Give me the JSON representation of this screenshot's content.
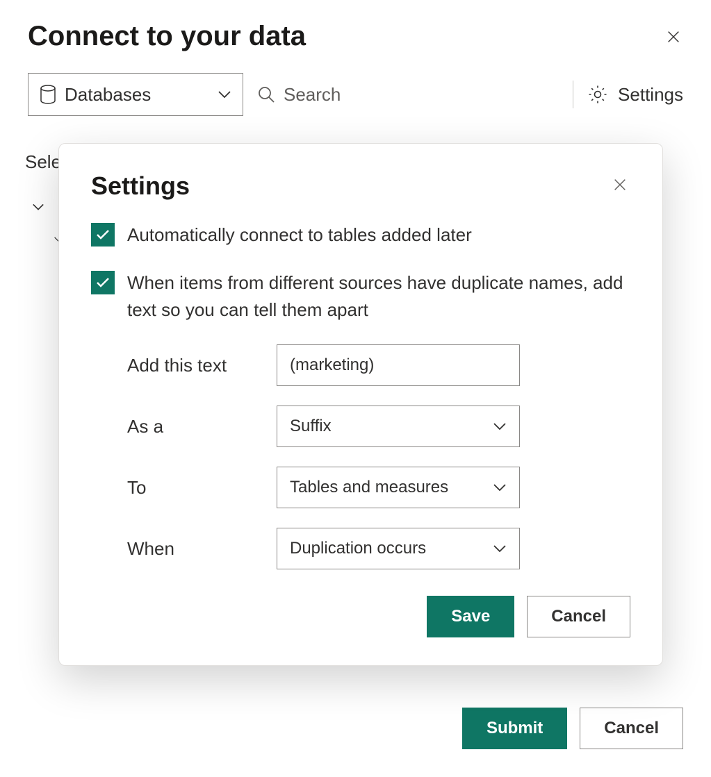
{
  "page": {
    "title": "Connect to your data"
  },
  "toolbar": {
    "dropdown_value": "Databases",
    "search_placeholder": "Search",
    "settings_label": "Settings"
  },
  "background": {
    "select_prefix": "Sele"
  },
  "modal": {
    "title": "Settings",
    "checkbox1_label": "Automatically connect to tables added later",
    "checkbox2_label": "When items from different sources have duplicate names, add text so you can tell them apart",
    "form": {
      "add_text_label": "Add this text",
      "add_text_value": "(marketing)",
      "as_a_label": "As a",
      "as_a_value": "Suffix",
      "to_label": "To",
      "to_value": "Tables and measures",
      "when_label": "When",
      "when_value": "Duplication occurs"
    },
    "save_label": "Save",
    "cancel_label": "Cancel"
  },
  "footer": {
    "submit_label": "Submit",
    "cancel_label": "Cancel"
  }
}
